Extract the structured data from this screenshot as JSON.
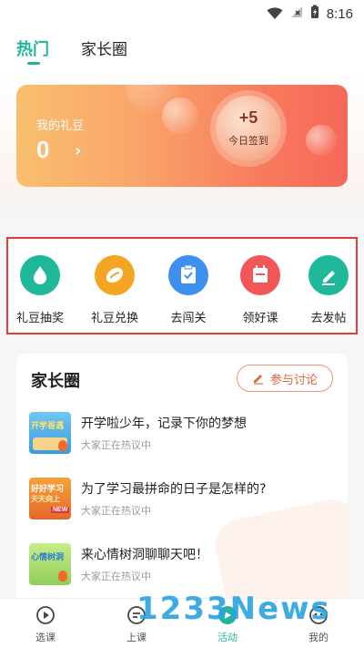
{
  "status_bar": {
    "time": "8:16"
  },
  "tabs": [
    {
      "label": "热门",
      "active": true
    },
    {
      "label": "家长圈",
      "active": false
    }
  ],
  "points_card": {
    "label": "我的礼豆",
    "value": "0",
    "checkin_points": "+5",
    "checkin_label": "今日签到"
  },
  "actions": [
    {
      "label": "礼豆抽奖",
      "icon": "drop-icon",
      "color": "#1fb89a"
    },
    {
      "label": "礼豆兑换",
      "icon": "bean-icon",
      "color": "#f5a524"
    },
    {
      "label": "去闯关",
      "icon": "clipboard-check-icon",
      "color": "#3f8fef"
    },
    {
      "label": "领好课",
      "icon": "calendar-icon",
      "color": "#f25757"
    },
    {
      "label": "去发帖",
      "icon": "edit-icon",
      "color": "#1fb89a"
    }
  ],
  "forum": {
    "title": "家长圈",
    "join_label": "参与讨论",
    "posts": [
      {
        "title": "开学啦少年，记录下你的梦想",
        "subtitle": "大家正在热议中",
        "thumb_text": "开学哥遇"
      },
      {
        "title": "为了学习最拼命的日子是怎样的?",
        "subtitle": "大家正在热议中",
        "thumb_text": "好好学习",
        "thumb_text2": "天天向上",
        "thumb_badge": "NEW"
      },
      {
        "title": "来心情树洞聊聊天吧！",
        "subtitle": "大家正在热议中",
        "thumb_text": "心情树洞"
      }
    ]
  },
  "bottom_nav": [
    {
      "label": "选课",
      "icon": "play-circle-icon",
      "active": false
    },
    {
      "label": "上课",
      "icon": "lesson-icon",
      "active": false
    },
    {
      "label": "活动",
      "icon": "activity-icon",
      "active": true
    },
    {
      "label": "我的",
      "icon": "profile-icon",
      "active": false
    }
  ],
  "watermark": "1233News",
  "colors": {
    "accent": "#21b69a",
    "highlight_border": "#e43b3b",
    "join": "#e8643c"
  }
}
